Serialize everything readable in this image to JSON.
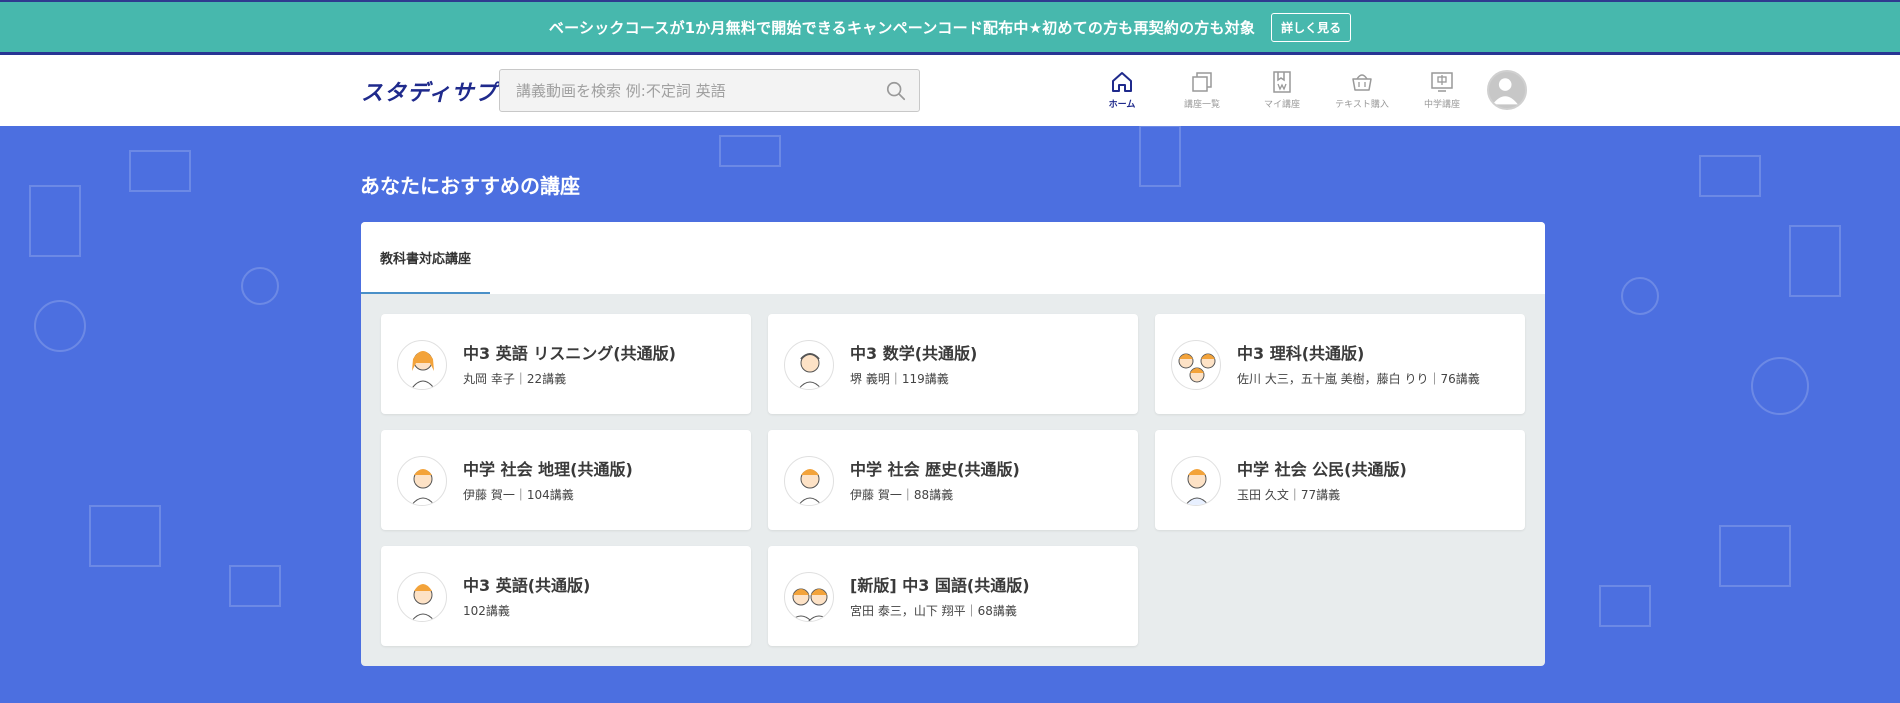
{
  "banner": {
    "text": "ベーシックコースが1か月無料で開始できるキャンペーンコード配布中★初めての方も再契約の方も対象",
    "button_label": "詳しく見る"
  },
  "header": {
    "logo": "スタディサプリ",
    "search_placeholder": "講義動画を検索 例:不定詞 英語",
    "nav": [
      {
        "label": "ホーム",
        "icon": "home-icon",
        "active": true
      },
      {
        "label": "講座一覧",
        "icon": "course-list-icon",
        "active": false
      },
      {
        "label": "マイ講座",
        "icon": "my-course-icon",
        "active": false
      },
      {
        "label": "テキスト購入",
        "icon": "basket-icon",
        "active": false
      },
      {
        "label": "中学講座",
        "icon": "junior-high-icon",
        "active": false
      }
    ]
  },
  "main": {
    "section_title": "あなたにおすすめの講座",
    "tab_label": "教科書対応講座",
    "courses": [
      {
        "title": "中3 英語 リスニング(共通版)",
        "sub": "丸岡 幸子｜22講義"
      },
      {
        "title": "中3 数学(共通版)",
        "sub": "堺 義明｜119講義"
      },
      {
        "title": "中3 理科(共通版)",
        "sub": "佐川 大三，五十嵐 美樹，藤白 りり｜76講義"
      },
      {
        "title": "中学 社会 地理(共通版)",
        "sub": "伊藤 賀一｜104講義"
      },
      {
        "title": "中学 社会 歴史(共通版)",
        "sub": "伊藤 賀一｜88講義"
      },
      {
        "title": "中学 社会 公民(共通版)",
        "sub": "玉田 久文｜77講義"
      },
      {
        "title": "中3 英語(共通版)",
        "sub": "102講義"
      },
      {
        "title": "[新版] 中3 国語(共通版)",
        "sub": "宮田 泰三，山下 翔平｜68講義"
      }
    ]
  },
  "colors": {
    "banner_bg": "#47b8ad",
    "brand_navy": "#1f2a8c",
    "page_bg": "#4c6fe0",
    "tab_underline": "#4a90c8"
  }
}
